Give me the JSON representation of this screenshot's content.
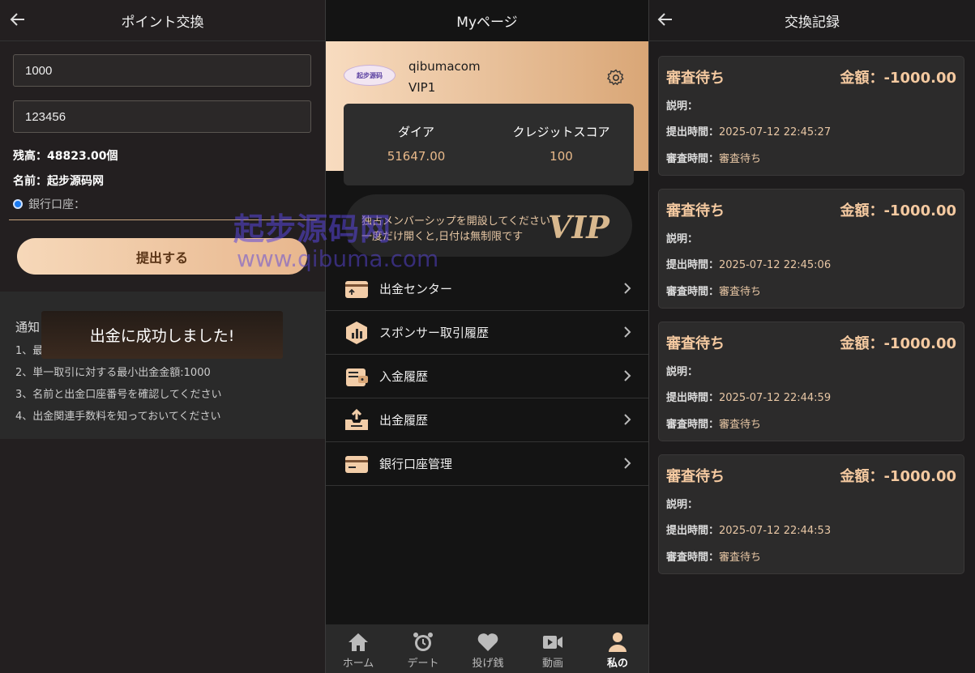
{
  "exchange": {
    "title": "ポイント交換",
    "amount_value": "1000",
    "password_value": "123456",
    "balance_label": "残高：",
    "balance_value": "48823.00個",
    "name_label": "名前：",
    "name_value": "起步源码网",
    "bank_label": "銀行口座：",
    "submit_label": "提出する",
    "notice_title": "通知",
    "notice_items": [
      "1、最",
      "2、単一取引に対する最小出金金額:1000",
      "3、名前と出金口座番号を確認してください",
      "4、出金関連手数料を知っておいてください"
    ],
    "toast": "出金に成功しました!"
  },
  "mypage": {
    "title": "Myページ",
    "avatar_text": "起步源码",
    "username": "qibumacom",
    "level": "VIP1",
    "stats": [
      {
        "label": "ダイア",
        "value": "51647.00"
      },
      {
        "label": "クレジットスコア",
        "value": "100"
      }
    ],
    "vip_banner": {
      "line1": "独占メンバーシップを開設してください",
      "line2": "一度だけ開くと,日付は無制限です",
      "logo": "VIP"
    },
    "menu": [
      {
        "label": "出金センター",
        "icon": "withdraw-center-icon"
      },
      {
        "label": "スポンサー取引履歴",
        "icon": "chart-icon"
      },
      {
        "label": "入金履歴",
        "icon": "wallet-icon"
      },
      {
        "label": "出金履歴",
        "icon": "tray-upload-icon"
      },
      {
        "label": "銀行口座管理",
        "icon": "card-icon"
      }
    ],
    "tabs": [
      {
        "label": "ホーム",
        "icon": "home-icon"
      },
      {
        "label": "デート",
        "icon": "alarm-clock-icon"
      },
      {
        "label": "投げ銭",
        "icon": "heart-icon"
      },
      {
        "label": "動画",
        "icon": "video-icon"
      },
      {
        "label": "私の",
        "icon": "user-icon"
      }
    ],
    "watermark_line1": "起步源码网",
    "watermark_line2": "www.qibuma.com"
  },
  "records": {
    "title": "交換記録",
    "items": [
      {
        "status": "審査待ち",
        "amount_label": "金額：",
        "amount": "-1000.00",
        "desc_label": "説明：",
        "submit_label": "提出時間：",
        "submit_time": "2025-07-12 22:45:27",
        "review_label": "審査時間：",
        "review_value": "審査待ち"
      },
      {
        "status": "審査待ち",
        "amount_label": "金額：",
        "amount": "-1000.00",
        "desc_label": "説明：",
        "submit_label": "提出時間：",
        "submit_time": "2025-07-12 22:45:06",
        "review_label": "審査時間：",
        "review_value": "審査待ち"
      },
      {
        "status": "審査待ち",
        "amount_label": "金額：",
        "amount": "-1000.00",
        "desc_label": "説明：",
        "submit_label": "提出時間：",
        "submit_time": "2025-07-12 22:44:59",
        "review_label": "審査時間：",
        "review_value": "審査待ち"
      },
      {
        "status": "審査待ち",
        "amount_label": "金額：",
        "amount": "-1000.00",
        "desc_label": "説明：",
        "submit_label": "提出時間：",
        "submit_time": "2025-07-12 22:44:53",
        "review_label": "審査時間：",
        "review_value": "審査待ち"
      }
    ]
  },
  "colors": {
    "accent": "#e8b98a",
    "toast_bg": "#3b2a1f",
    "radio": "#1a7af0"
  }
}
